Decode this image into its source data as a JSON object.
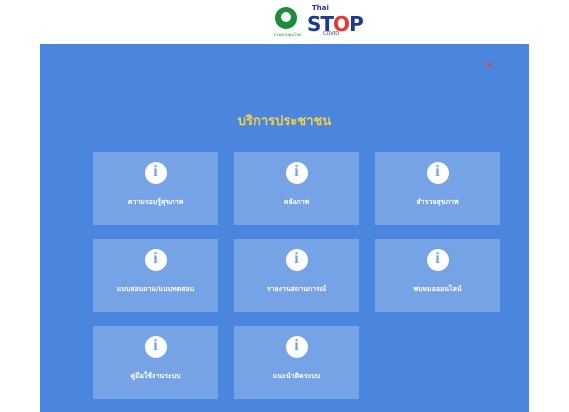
{
  "header": {
    "moph_small_text": "กรมควบคุมโรค",
    "logo_thai": "Thai",
    "logo_stop_s": "ST",
    "logo_stop_o": "O",
    "logo_stop_p": "P",
    "logo_covid": "COVID"
  },
  "modal": {
    "close_symbol": "✕",
    "title": "บริการประชาชน",
    "tiles": [
      {
        "label": "ความรอบรู้สุขภาพ"
      },
      {
        "label": "คลังภาพ"
      },
      {
        "label": "สำรวจสุขภาพ"
      },
      {
        "label": "แบบสอบถาม/แบบทดสอบ"
      },
      {
        "label": "รายงานสถานการณ์"
      },
      {
        "label": "พบหมอออนไลน์"
      },
      {
        "label": "คู่มือใช้งานระบบ"
      },
      {
        "label": "แนะนำติดระบบ"
      }
    ]
  },
  "colors": {
    "modal_bg": "#4a86de",
    "tile_bg": "#76a2e6",
    "title": "#f2cf45",
    "close": "#d44b4b"
  }
}
